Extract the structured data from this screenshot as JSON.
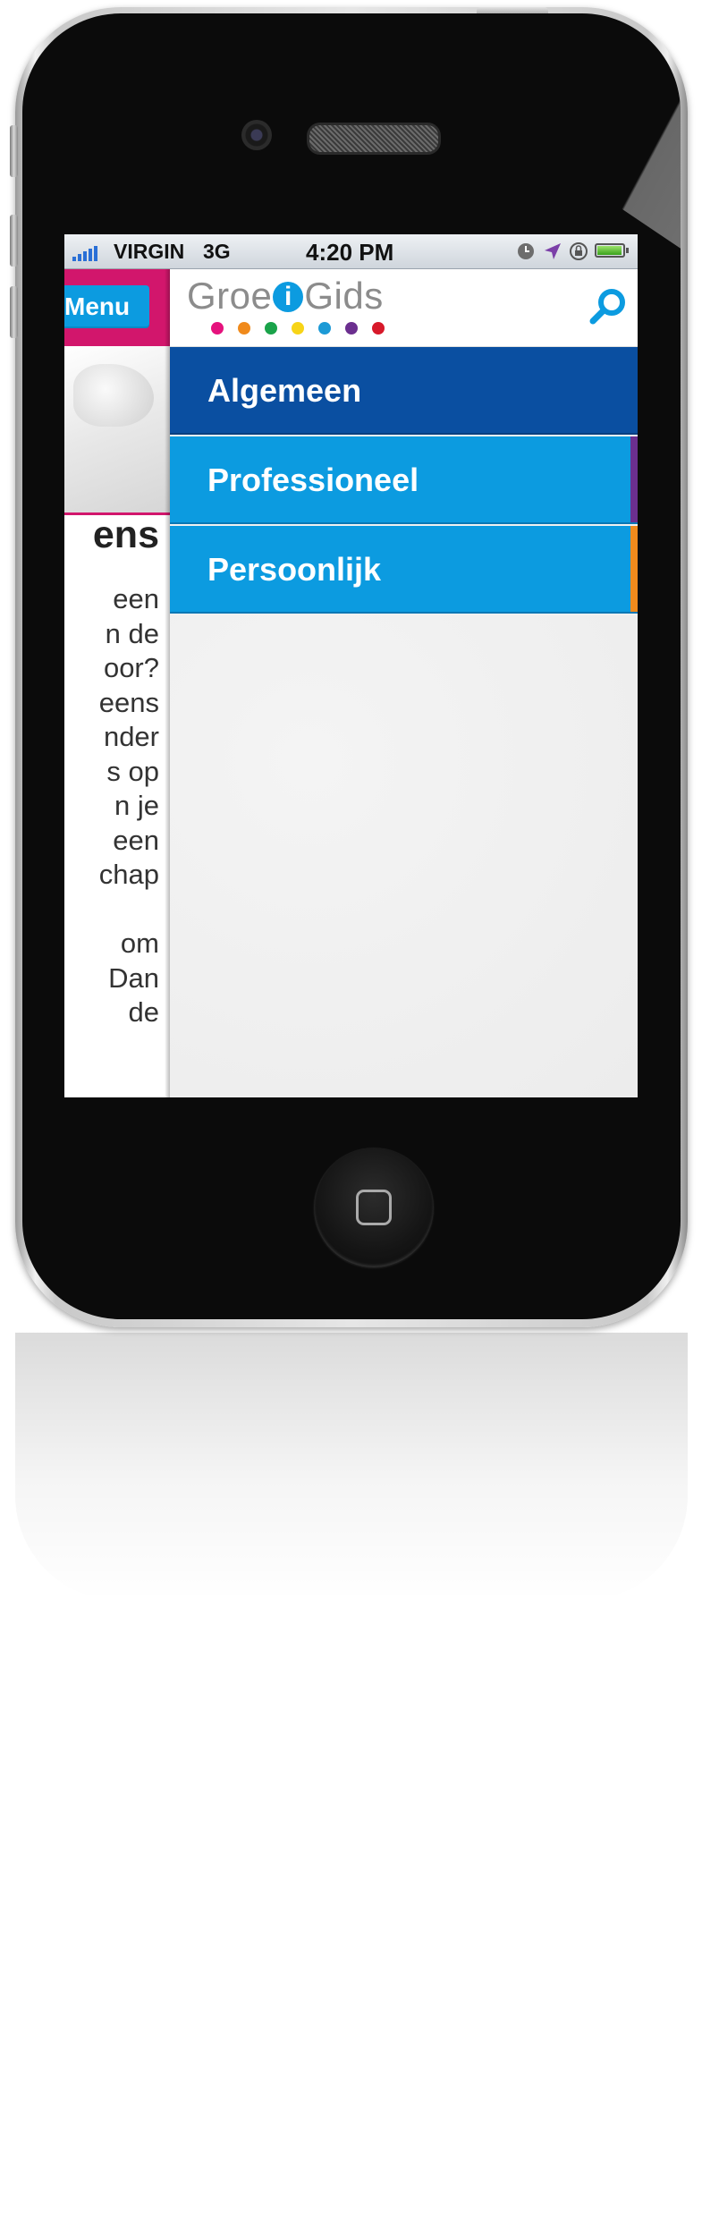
{
  "status_bar": {
    "carrier": "VIRGIN",
    "network": "3G",
    "time": "4:20 PM"
  },
  "underlying_page": {
    "menu_button_label": "Menu",
    "title_fragment": "ens",
    "text_fragments": [
      "een",
      "n de",
      "oor?",
      "eens",
      "nder",
      "s op",
      "n je",
      "een",
      "chap",
      "",
      "om",
      "Dan",
      "de"
    ]
  },
  "brand": {
    "logo_prefix": "Groe",
    "logo_i": "i",
    "logo_suffix": "Gids",
    "dot_colors": [
      "#e5127d",
      "#f08a1c",
      "#1aa34a",
      "#f7d417",
      "#1c9ad6",
      "#6b2f8f",
      "#d7192a"
    ]
  },
  "menu": {
    "items": [
      {
        "label": "Algemeen",
        "color": "#0a4fa1",
        "tab_color": ""
      },
      {
        "label": "Professioneel",
        "color": "#0c9be0",
        "tab_color": "#6b2f8f"
      },
      {
        "label": "Persoonlijk",
        "color": "#0c9be0",
        "tab_color": "#f08a1c"
      }
    ]
  },
  "icons": {
    "search": "search-icon",
    "alarm": "alarm-icon",
    "location": "location-arrow-icon",
    "rotation_lock": "rotation-lock-icon",
    "battery": "battery-icon",
    "signal": "signal-bars-icon"
  },
  "colors": {
    "accent_blue": "#0c9be0",
    "active_blue": "#0a4fa1",
    "header_pink": "#d2166c"
  },
  "battery_level": 0.9
}
